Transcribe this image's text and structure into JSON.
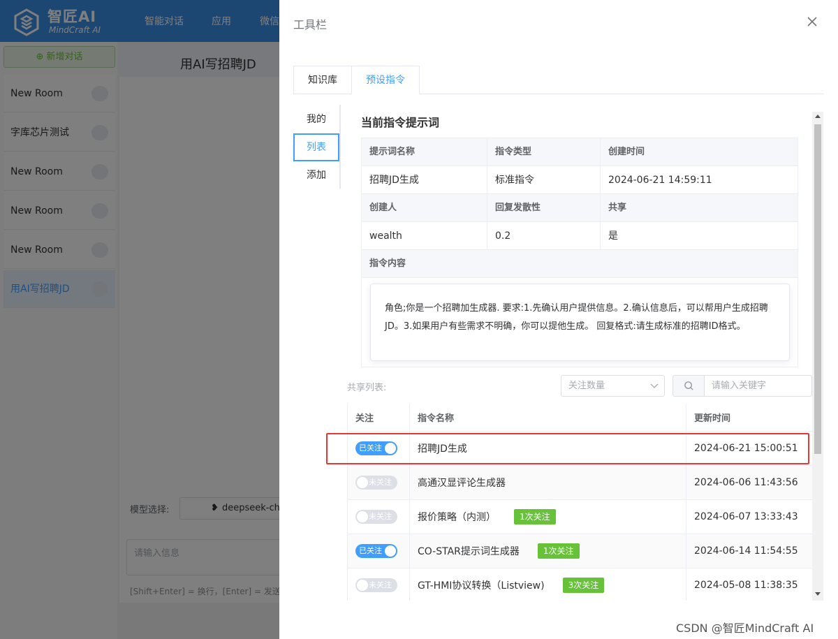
{
  "app": {
    "logo_name": "智匠AI",
    "logo_sub": "MindCraft AI",
    "nav": [
      "智能对话",
      "应用",
      "微信"
    ],
    "new_chat": "新增对话",
    "rooms": [
      "New Room",
      "字库芯片测试",
      "New Room",
      "New Room",
      "New Room",
      "用AI写招聘JD"
    ],
    "chat_title": "用AI写招聘JD",
    "model_label": "模型选择:",
    "model_value": "deepseek-ch",
    "input_placeholder": "请输入信息",
    "hint": "[Shift+Enter] = 换行，[Enter] = 发送信"
  },
  "drawer": {
    "title": "工具栏",
    "tabs": [
      "知识库",
      "预设指令"
    ],
    "subnav": [
      "我的",
      "列表",
      "添加"
    ],
    "section_title": "当前指令提示词",
    "info": {
      "h1": [
        "提示词名称",
        "指令类型",
        "创建时间"
      ],
      "v1": [
        "招聘JD生成",
        "标准指令",
        "2024-06-21 14:59:11"
      ],
      "h2": [
        "创建人",
        "回复发散性",
        "共享"
      ],
      "v2": [
        "wealth",
        "0.2",
        "是"
      ],
      "h3": "指令内容",
      "content": "角色;你是一个招聘加生成器. 要求:1.先确认用户提供信息。2.确认信息后，可以帮用户生成招聘JD。3.如果用户有些需求不明确，你可以提他生成。 回复格式:请生成标准的招聘ID格式。"
    },
    "share_label": "共享列表:",
    "sort_placeholder": "关注数量",
    "search_placeholder": "请输入关键字",
    "table_headers": [
      "关注",
      "指令名称",
      "更新时间"
    ],
    "rows": [
      {
        "followed": true,
        "switch": "已关注",
        "name": "招聘JD生成",
        "badge": "",
        "time": "2024-06-21 15:00:51"
      },
      {
        "followed": false,
        "switch": "未关注",
        "name": "高通汉显评论生成器",
        "badge": "",
        "time": "2024-06-06 11:43:56"
      },
      {
        "followed": false,
        "switch": "未关注",
        "name": "报价策略（内测）",
        "badge": "1次关注",
        "time": "2024-06-07 13:33:43"
      },
      {
        "followed": true,
        "switch": "已关注",
        "name": "CO-STAR提示词生成器",
        "badge": "1次关注",
        "time": "2024-06-14 11:54:55"
      },
      {
        "followed": false,
        "switch": "未关注",
        "name": "GT-HMI协议转换（Listview)",
        "badge": "3次关注",
        "time": "2024-05-08 11:38:35"
      }
    ]
  },
  "watermark": "CSDN @智匠MindCraft AI",
  "colors": {
    "primary": "#409eff",
    "success": "#67c23a",
    "highlight": "#e53935"
  }
}
